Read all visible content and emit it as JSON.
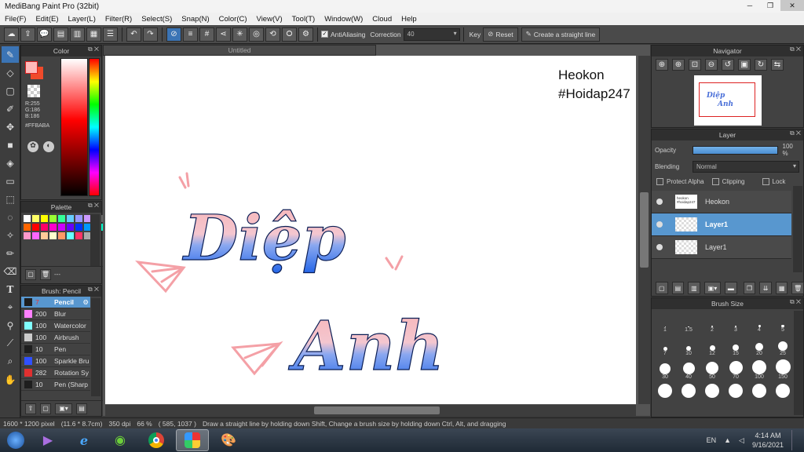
{
  "window": {
    "title": "MediBang Paint Pro (32bit)"
  },
  "menu": [
    "File(F)",
    "Edit(E)",
    "Layer(L)",
    "Filter(R)",
    "Select(S)",
    "Snap(N)",
    "Color(C)",
    "View(V)",
    "Tool(T)",
    "Window(W)",
    "Cloud",
    "Help"
  ],
  "toolbar": {
    "antialiasing_label": "AntiAliasing",
    "correction_label": "Correction",
    "correction_value": "40",
    "key_label": "Key",
    "reset_label": "Reset",
    "straight_line_label": "Create a straight line"
  },
  "color_panel": {
    "title": "Color",
    "r": "R:255",
    "g": "G:186",
    "b": "B:186",
    "hex": "#FFBABA",
    "foreground": "#ffbaba",
    "accent": "#e02020"
  },
  "palette_panel": {
    "title": "Palette",
    "dash": "---",
    "colors": [
      "#ffffff",
      "#ffff66",
      "#ffff00",
      "#99ff33",
      "#33ff99",
      "#66ccff",
      "#9999ff",
      "#cc99ff",
      "#aaaaaa",
      "#666666",
      "#ff6600",
      "#ff0000",
      "#ff0066",
      "#ff00cc",
      "#cc00ff",
      "#6600ff",
      "#0033ff",
      "#0099ff",
      "#00ccff",
      "#00ffcc",
      "#ff99cc",
      "#ff66ff",
      "#ffcc99",
      "#ffffcc",
      "#ff9966",
      "#66ffff",
      "#ff3366",
      "#aaaaaa"
    ]
  },
  "brush_panel": {
    "title": "Brush: Pencil",
    "items": [
      {
        "size": "7",
        "name": "Pencil",
        "color": "#1e1e1e",
        "selected": true
      },
      {
        "size": "200",
        "name": "Blur",
        "color": "#ff80ff"
      },
      {
        "size": "100",
        "name": "Watercolor",
        "color": "#80ffff"
      },
      {
        "size": "100",
        "name": "Airbrush",
        "color": "#cccccc"
      },
      {
        "size": "10",
        "name": "Pen",
        "color": "#1e1e1e"
      },
      {
        "size": "100",
        "name": "Sparkle Bru",
        "color": "#3050ff"
      },
      {
        "size": "282",
        "name": "Rotation Sy",
        "color": "#e03030"
      },
      {
        "size": "10",
        "name": "Pen (Sharp",
        "color": "#1e1e1e"
      }
    ]
  },
  "canvas": {
    "tab_title": "Untitled",
    "watermark_line1": "Heokon",
    "watermark_line2": "#Hoidap247",
    "word1": "Diệp",
    "word2": "Anh"
  },
  "navigator": {
    "title": "Navigator",
    "thumb_word1": "Diệp",
    "thumb_word2": "Anh"
  },
  "layer_panel": {
    "title": "Layer",
    "opacity_label": "Opacity",
    "opacity_value": "100 %",
    "opacity_fraction": 1.0,
    "blending_label": "Blending",
    "blending_value": "Normal",
    "protect_alpha": "Protect Alpha",
    "clipping": "Clipping",
    "lock": "Lock",
    "layers": [
      {
        "name": "Heokon",
        "thumb_text": "heokon #hoidap247",
        "selected": false
      },
      {
        "name": "Layer1",
        "selected": true
      },
      {
        "name": "Layer1",
        "selected": false
      }
    ]
  },
  "brush_size_panel": {
    "title": "Brush Size",
    "sizes": [
      "1",
      "1.5",
      "2",
      "3",
      "4",
      "5",
      "7",
      "10",
      "12",
      "15",
      "20",
      "25",
      "30",
      "40",
      "50",
      "70",
      "100",
      "150",
      "",
      "",
      "",
      "",
      "",
      ""
    ]
  },
  "status": {
    "dimensions": "1600 * 1200 pixel",
    "physical": "(11.6 * 8.7cm)",
    "dpi": "350 dpi",
    "zoom": "66 %",
    "coords": "( 585, 1037 )",
    "hint": "Draw a straight line by holding down Shift, Change a brush size by holding down Ctrl, Alt, and dragging"
  },
  "taskbar": {
    "lang": "EN",
    "time": "4:14 AM",
    "date": "9/16/2021"
  }
}
